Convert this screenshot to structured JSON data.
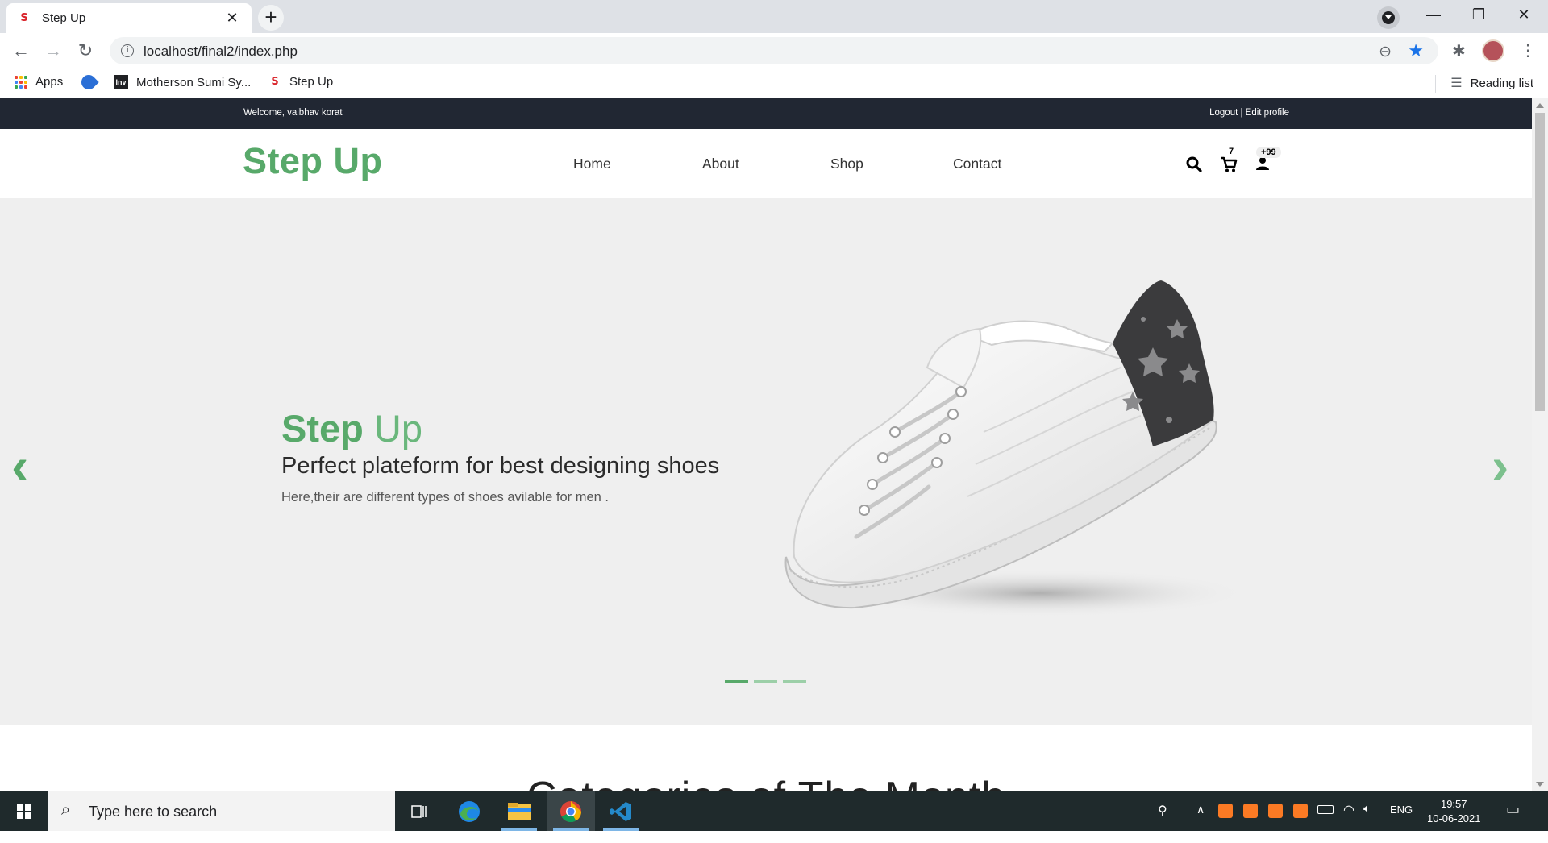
{
  "browser": {
    "tab_title": "Step Up",
    "favicon_letter": "S",
    "url": "localhost/final2/index.php",
    "bookmarks": [
      {
        "label": "Apps"
      },
      {
        "label": ""
      },
      {
        "label": "Motherson Sumi Sy..."
      },
      {
        "label": "Step Up"
      }
    ],
    "reading_list": "Reading list"
  },
  "site": {
    "topbar": {
      "welcome": "Welcome, vaibhav korat",
      "account_links": "Logout | Edit profile"
    },
    "logo": "Step Up",
    "menu": [
      "Home",
      "About",
      "Shop",
      "Contact"
    ],
    "cart_count": "7",
    "user_badge": "+99",
    "hero": {
      "title_bold": "Step",
      "title_light": "Up",
      "subtitle": "Perfect plateform for best designing shoes",
      "text": "Here,their are different types of shoes avilable for men .",
      "slides": 3,
      "active_slide": 1
    },
    "section_title": "Categories of The Month"
  },
  "taskbar": {
    "search_placeholder": "Type here to search",
    "language": "ENG",
    "time": "19:57",
    "date": "10-06-2021"
  },
  "colors": {
    "brand_green": "#58a96a",
    "topbar_dark": "#212733",
    "hero_bg": "#efefef"
  }
}
